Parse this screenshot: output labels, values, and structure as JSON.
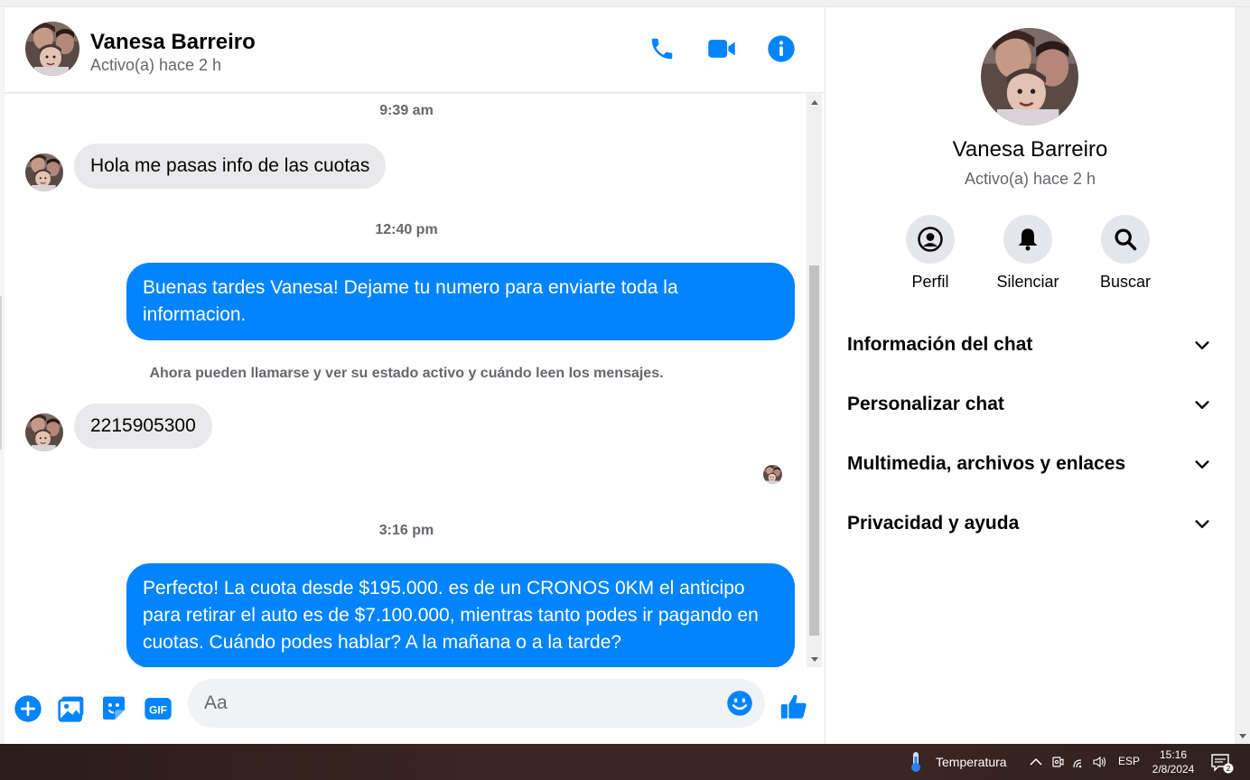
{
  "contact": {
    "name": "Vanesa Barreiro",
    "status": "Activo(a) hace 2 h"
  },
  "colors": {
    "accent": "#0084ff",
    "incoming_bubble": "#e9e9eb",
    "secondary_text": "#65676b"
  },
  "header_icons": [
    "phone-icon",
    "video-camera-icon",
    "info-icon"
  ],
  "messages": {
    "ts1": "9:39 am",
    "m1": "Hola me pasas info de las cuotas",
    "ts2": "12:40 pm",
    "m2": "Buenas tardes Vanesa! Dejame tu numero para enviarte toda la informacion.",
    "system": "Ahora pueden llamarse y ver su estado activo y cuándo leen los mensajes.",
    "m3": "2215905300",
    "ts3": "3:16 pm",
    "m4": "Perfecto! La cuota desde $195.000. es de un CRONOS 0KM el anticipo para retirar el auto es de $7.100.000, mientras tanto podes ir pagando en cuotas. Cuándo podes hablar? A la mañana o a la tarde?"
  },
  "composer": {
    "placeholder": "Aa",
    "icons": [
      "plus-icon",
      "image-icon",
      "sticker-icon",
      "gif-icon",
      "emoji-icon",
      "thumbs-up-icon"
    ],
    "gif_label": "GIF"
  },
  "sidebar": {
    "actions": [
      {
        "label": "Perfil",
        "icon": "profile-icon"
      },
      {
        "label": "Silenciar",
        "icon": "bell-icon"
      },
      {
        "label": "Buscar",
        "icon": "search-icon"
      }
    ],
    "sections": [
      {
        "label": "Información del chat"
      },
      {
        "label": "Personalizar chat"
      },
      {
        "label": "Multimedia, archivos y enlaces"
      },
      {
        "label": "Privacidad y ayuda"
      }
    ]
  },
  "taskbar": {
    "weather_label": "Temperatura",
    "language": "ESP",
    "time": "15:16",
    "date": "2/8/2024",
    "notification_count": "2"
  }
}
